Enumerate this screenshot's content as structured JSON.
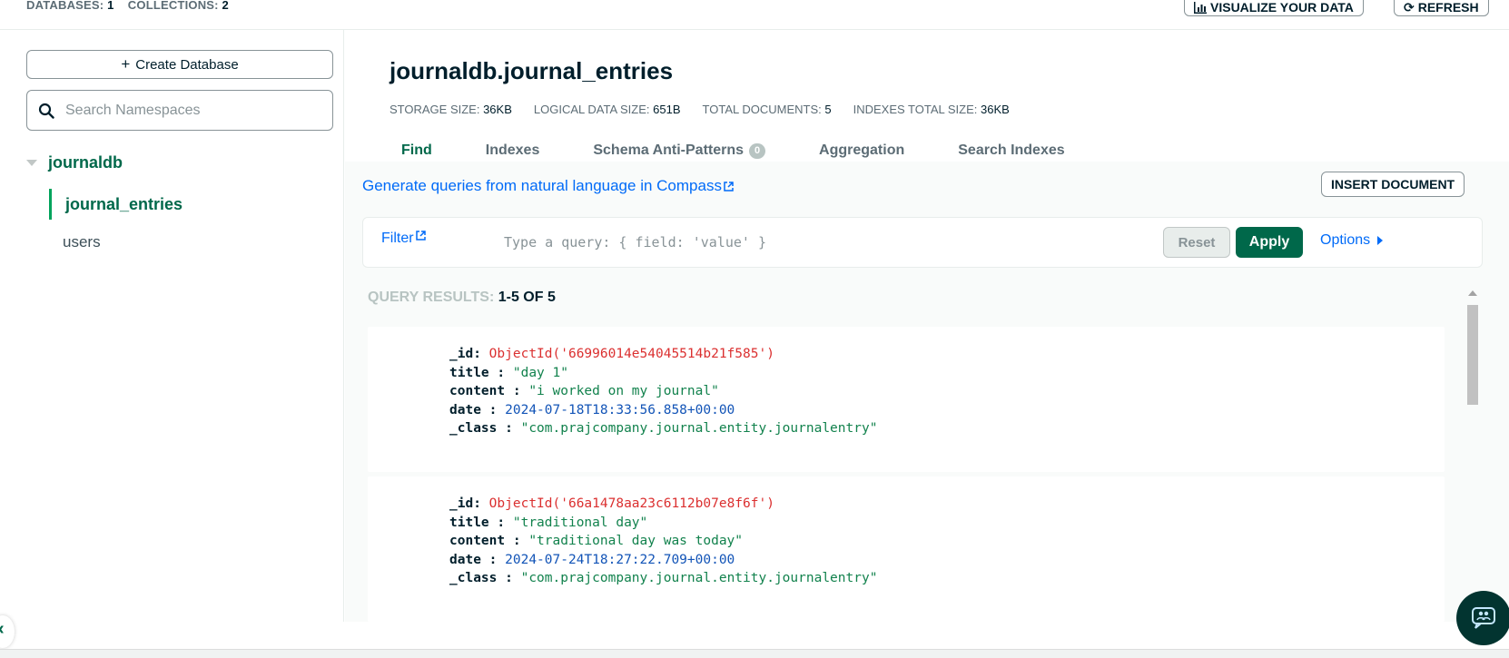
{
  "topbar": {
    "databases_label": "DATABASES:",
    "databases_count": "1",
    "collections_label": "COLLECTIONS:",
    "collections_count": "2",
    "visualize_label": "VISUALIZE YOUR DATA",
    "refresh_label": "REFRESH"
  },
  "sidebar": {
    "create_db_label": "Create Database",
    "search_placeholder": "Search Namespaces",
    "database": "journaldb",
    "collections": [
      "journal_entries",
      "users"
    ]
  },
  "main": {
    "namespace": "journaldb.journal_entries",
    "stats": {
      "storage_label": "STORAGE SIZE:",
      "storage_value": "36KB",
      "logical_label": "LOGICAL DATA SIZE:",
      "logical_value": "651B",
      "docs_label": "TOTAL DOCUMENTS:",
      "docs_value": "5",
      "indexes_label": "INDEXES TOTAL SIZE:",
      "indexes_value": "36KB"
    },
    "tabs": [
      {
        "label": "Find"
      },
      {
        "label": "Indexes"
      },
      {
        "label": "Schema Anti-Patterns",
        "badge": "0"
      },
      {
        "label": "Aggregation"
      },
      {
        "label": "Search Indexes"
      }
    ],
    "nl_link": "Generate queries from natural language in Compass",
    "insert_label": "INSERT DOCUMENT",
    "filter_label": "Filter",
    "query_placeholder": "Type a query: { field: 'value' }",
    "reset_label": "Reset",
    "apply_label": "Apply",
    "options_label": "Options",
    "results_label": "QUERY RESULTS:",
    "results_count": "1-5 OF 5",
    "documents": [
      {
        "id_key": "_id",
        "id_val": "ObjectId('66996014e54045514b21f585')",
        "title_key": "title",
        "title_val": "\"day 1\"",
        "content_key": "content",
        "content_val": "\"i worked on my journal\"",
        "date_key": "date",
        "date_val": "2024-07-18T18:33:56.858+00:00",
        "class_key": "_class",
        "class_val": "\"com.prajcompany.journal.entity.journalentry\""
      },
      {
        "id_key": "_id",
        "id_val": "ObjectId('66a1478aa23c6112b07e8f6f')",
        "title_key": "title",
        "title_val": "\"traditional day\"",
        "content_key": "content",
        "content_val": "\"traditional day was today\"",
        "date_key": "date",
        "date_val": "2024-07-24T18:27:22.709+00:00",
        "class_key": "_class",
        "class_val": "\"com.prajcompany.journal.entity.journalentry\""
      }
    ]
  },
  "colors": {
    "accent": "#00684a",
    "link": "#016bf8",
    "objectid": "#db3030",
    "string": "#12824d",
    "date": "#1254b7"
  }
}
